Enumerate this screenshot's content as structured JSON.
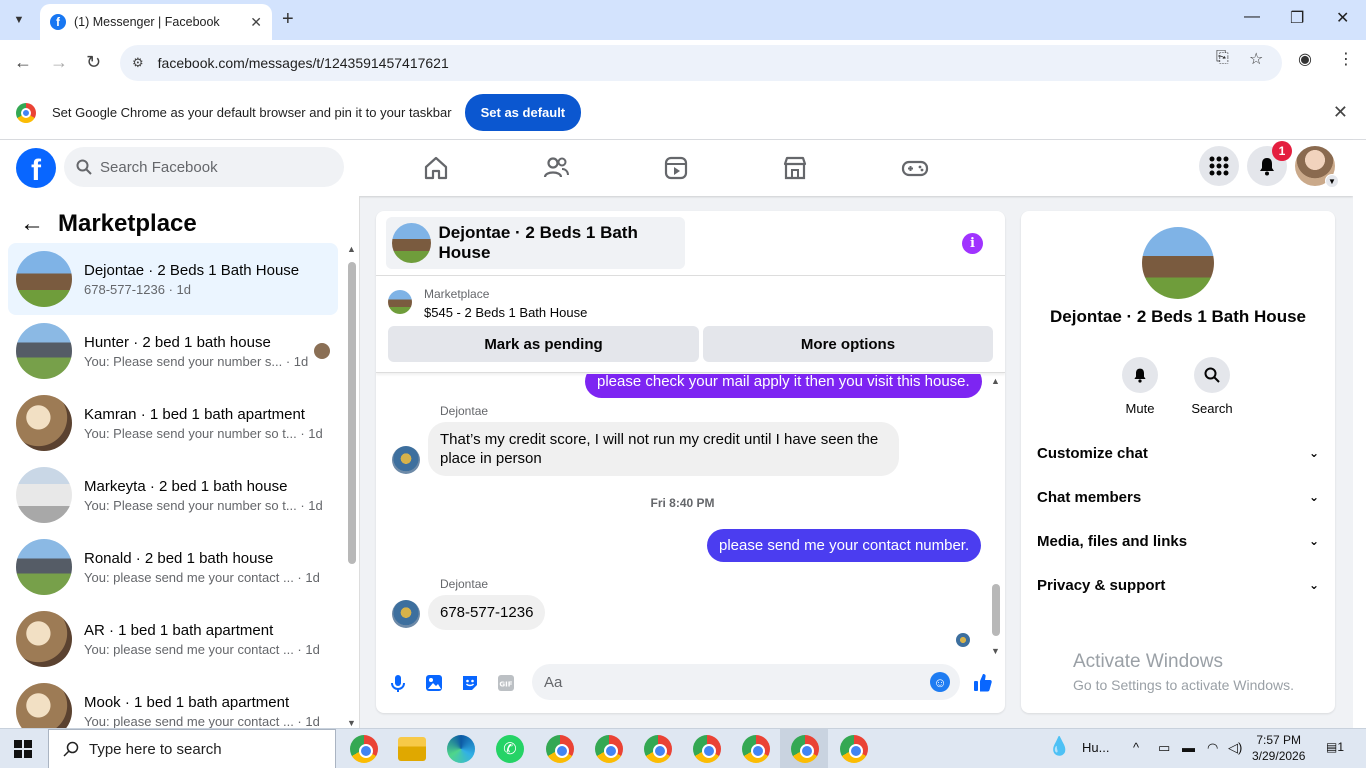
{
  "browser": {
    "tab_title": "(1) Messenger | Facebook",
    "tab_favicon": "f",
    "url": "facebook.com/messages/t/1243591457417621",
    "infobar_message": "Set Google Chrome as your default browser and pin it to your taskbar",
    "infobar_button": "Set as default"
  },
  "facebook": {
    "search_placeholder": "Search Facebook",
    "notification_count": "1",
    "logo_letter": "f"
  },
  "sidebar": {
    "heading": "Marketplace",
    "conversations": [
      {
        "name": "Dejontae · 2 Beds 1 Bath House",
        "preview": "678-577-1236 · 1d",
        "active": true
      },
      {
        "name": "Hunter · 2 bed 1 bath house",
        "preview": "You: Please send your number s... · 1d"
      },
      {
        "name": "Kamran · 1 bed 1 bath apartment",
        "preview": "You: Please send your number so t... · 1d"
      },
      {
        "name": "Markeyta · 2 bed 1 bath house",
        "preview": "You: Please send your number so t... · 1d"
      },
      {
        "name": "Ronald · 2 bed 1 bath house",
        "preview": "You: please send me your contact ... · 1d"
      },
      {
        "name": "AR · 1 bed 1 bath apartment",
        "preview": "You: please send me your contact ... · 1d"
      },
      {
        "name": "Mook · 1 bed 1 bath apartment",
        "preview": "You: please send me your contact ... · 1d"
      }
    ]
  },
  "chat": {
    "title": "Dejontae · 2 Beds 1 Bath House",
    "marketplace_label": "Marketplace",
    "listing": "$545 - 2 Beds 1 Bath House",
    "mark_pending": "Mark as pending",
    "more_options": "More options",
    "messages": [
      {
        "from": "me",
        "text": "please check your mail apply it then you visit this house."
      },
      {
        "from": "Dejontae",
        "text": "That’s my credit score, I will not run my credit until I have seen the place in person"
      },
      {
        "timestamp": "Fri 8:40 PM"
      },
      {
        "from": "me",
        "text": "please send me your contact number."
      },
      {
        "from": "Dejontae",
        "text": "678-577-1236"
      }
    ],
    "composer_placeholder": "Aa"
  },
  "details": {
    "name": "Dejontae · 2 Beds 1 Bath House",
    "mute": "Mute",
    "search": "Search",
    "sections": [
      "Customize chat",
      "Chat members",
      "Media, files and links",
      "Privacy & support"
    ]
  },
  "watermark": {
    "line1": "Activate Windows",
    "line2": "Go to Settings to activate Windows."
  },
  "taskbar": {
    "search_placeholder": "Type here to search",
    "weather": "Hu...",
    "time": "7:57 PM",
    "date": "3/29/2026",
    "notifications": "1"
  },
  "colors": {
    "fb_blue": "#0866ff",
    "messenger_purple": "#7d25f2",
    "messenger_blue": "#4b3df0",
    "chrome_button": "#0b57d0",
    "badge_red": "#e41e3f"
  }
}
